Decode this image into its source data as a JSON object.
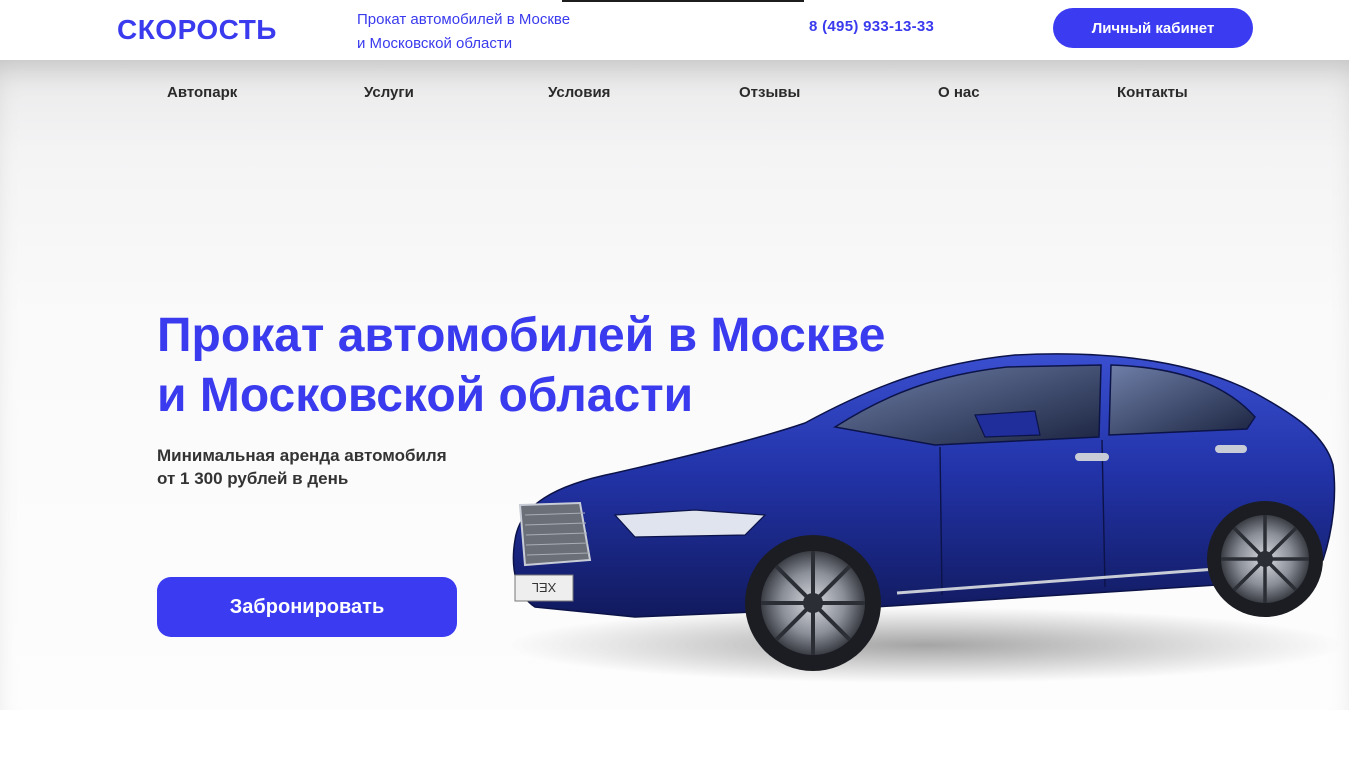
{
  "header": {
    "logo": "СКОРОСТЬ",
    "tagline_line1": "Прокат автомобилей в Москве",
    "tagline_line2": "и Московской области",
    "phone": "8 (495) 933-13-33",
    "account_button": "Личный кабинет"
  },
  "nav": {
    "items": [
      {
        "label": "Автопарк"
      },
      {
        "label": "Услуги"
      },
      {
        "label": "Условия"
      },
      {
        "label": "Отзывы"
      },
      {
        "label": "О нас"
      },
      {
        "label": "Контакты"
      }
    ]
  },
  "hero": {
    "title_line1": "Прокат автомобилей в Москве",
    "title_line2": "и Московской области",
    "subtitle_line1": "Минимальная аренда автомобиля",
    "subtitle_line2": "от 1 300 рублей в день",
    "book_button": "Забронировать",
    "car_plate": "XEL"
  },
  "colors": {
    "accent": "#3b3bf2",
    "text_dark": "#2a2a2a",
    "car_body": "#2233a8"
  }
}
